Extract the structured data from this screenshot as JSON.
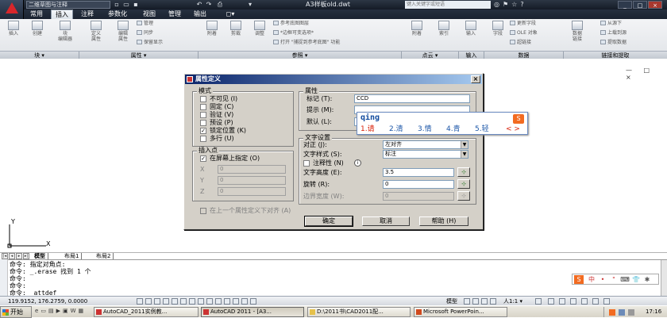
{
  "titlebar": {
    "workspace": "二维草图与注释",
    "file_title": "A3样板old.dwt",
    "search_placeholder": "键入关键字或短语",
    "min": "_",
    "restore": "□",
    "close": "×"
  },
  "tabs": [
    "常用",
    "插入",
    "注释",
    "参数化",
    "视图",
    "管理",
    "输出",
    "◻▾"
  ],
  "ribbon": {
    "block": {
      "insert": "插入",
      "create": "创建",
      "edit": "块\n编辑器"
    },
    "attributes": {
      "define": "定义\n属性",
      "edit": "编辑\n属性",
      "manage": "管理",
      "sync": "同步",
      "keep": "保留显示"
    },
    "reference": {
      "attach": "附着",
      "clip": "剪裁",
      "adjust": "调整",
      "underlay_layers": "参考底图图层",
      "frames": "*边框可变选项*",
      "snap": "打开 \"捕捉到参考底图\" 功能"
    },
    "pointcloud": {
      "attach": "附着",
      "index": "索引"
    },
    "import": {
      "import": "输入"
    },
    "data": {
      "field": "字段",
      "update": "更新字段",
      "ole": "OLE 对象",
      "hyperlink": "超链接"
    },
    "linking": {
      "link": "数据\n链接",
      "from_source": "从源下",
      "upload": "上载到源",
      "extract": "提取数据"
    }
  },
  "panels": [
    "块 ▾",
    "属性 ▾",
    "参照 ▾",
    "点云 ▾",
    "输入",
    "数据",
    "链接和提取"
  ],
  "viewport_controls": "— □ ×",
  "ucs": {
    "x": "X",
    "y": "Y"
  },
  "layout_tabs": {
    "model": "模型",
    "layout1": "布局1",
    "layout2": "布局2"
  },
  "command_lines": [
    "命令: 指定对角点:",
    "命令: _.erase 找到 1 个",
    "命令:",
    "命令:",
    "命令: _attdef"
  ],
  "ime_toolbar": [
    "S",
    "中",
    "•",
    "\"",
    "⌨",
    "👕",
    "✱"
  ],
  "statusbar": {
    "coords": "119.9152, 176.2759, 0.0000",
    "model": "模型",
    "scale": "人1:1 ▾"
  },
  "taskbar": {
    "start": "开始",
    "items": [
      "AutoCAD_2011实例教...",
      "AutoCAD 2011 - [A3...",
      "D:\\2011书\\CAD2011配...",
      "Microsoft PowerPoin..."
    ],
    "clock": "17:16"
  },
  "dialog": {
    "title": "属性定义",
    "close": "×",
    "mode_group": "模式",
    "modes": [
      {
        "label": "不可见 (I)",
        "checked": false
      },
      {
        "label": "固定 (C)",
        "checked": false
      },
      {
        "label": "验证 (V)",
        "checked": false
      },
      {
        "label": "预设 (P)",
        "checked": false
      },
      {
        "label": "锁定位置 (K)",
        "checked": true
      },
      {
        "label": "多行 (U)",
        "checked": false
      }
    ],
    "insert_group": "插入点",
    "specify_on_screen": "在屏幕上指定 (O)",
    "coord_labels": [
      "X",
      "Y",
      "Z"
    ],
    "coord_values": [
      "0",
      "0",
      "0"
    ],
    "align_below": "在上一个属性定义下对齐 (A)",
    "attr_group": "属性",
    "tag_label": "标记 (T):",
    "tag_value": "CCD",
    "prompt_label": "提示 (M):",
    "prompt_value": "",
    "default_label": "默认 (L):",
    "default_value": "",
    "text_group": "文字设置",
    "justify_label": "对正 (J):",
    "justify_value": "左对齐",
    "style_label": "文字样式 (S):",
    "style_value": "标注",
    "annotative_label": "注释性 (N)",
    "height_label": "文字高度 (E):",
    "height_value": "3.5",
    "rotation_label": "旋转 (R):",
    "rotation_value": "0",
    "boundary_label": "边界宽度 (W):",
    "boundary_value": "0",
    "ok": "确定",
    "cancel": "取消",
    "help": "帮助 (H)"
  },
  "ime": {
    "pinyin": "qing",
    "candidates": [
      "1.请",
      "2.清",
      "3.情",
      "4.青",
      "5.轻"
    ],
    "nav": "< >",
    "logo": "S"
  }
}
